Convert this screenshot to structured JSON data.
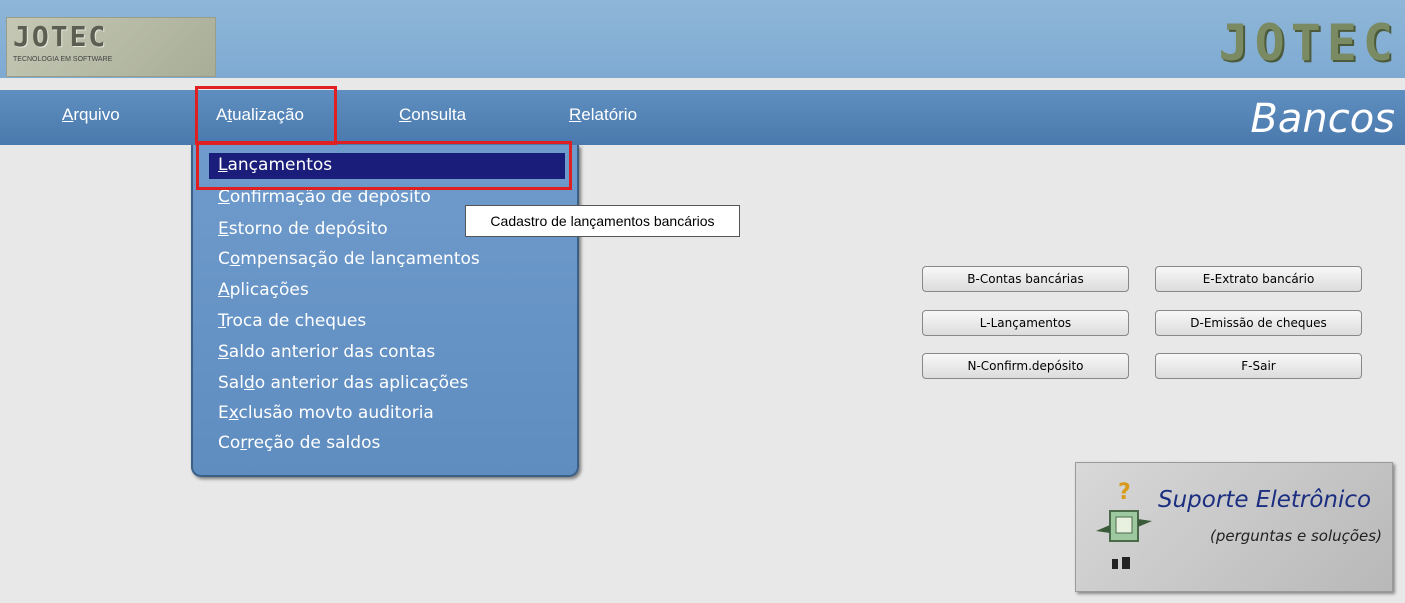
{
  "header": {
    "logo_text": "JOTEC",
    "logo_subtitle": "TECNOLOGIA EM SOFTWARE",
    "brand_text": "JOTEC"
  },
  "menubar": {
    "items": [
      {
        "label_hotkey": "A",
        "label_rest": "rquivo"
      },
      {
        "label_pre": "A",
        "label_hotkey": "t",
        "label_rest": "ualização"
      },
      {
        "label_hotkey": "C",
        "label_rest": "onsulta"
      },
      {
        "label_hotkey": "R",
        "label_rest": "elatório"
      }
    ],
    "page_title": "Bancos"
  },
  "dropdown": {
    "items": [
      {
        "pre": "",
        "hotkey": "L",
        "rest": "ançamentos",
        "selected": true
      },
      {
        "pre": "",
        "hotkey": "C",
        "rest": "onfirmação de depósito"
      },
      {
        "pre": "",
        "hotkey": "E",
        "rest": "storno de depósito"
      },
      {
        "pre": "C",
        "hotkey": "o",
        "rest": "mpensação de lançamentos"
      },
      {
        "pre": "",
        "hotkey": "A",
        "rest": "plicações"
      },
      {
        "pre": "",
        "hotkey": "T",
        "rest": "roca de cheques"
      },
      {
        "pre": "",
        "hotkey": "S",
        "rest": "aldo anterior das contas"
      },
      {
        "pre": "Sal",
        "hotkey": "d",
        "rest": "o anterior das aplicações"
      },
      {
        "pre": "E",
        "hotkey": "x",
        "rest": "clusão movto auditoria"
      },
      {
        "pre": "Co",
        "hotkey": "r",
        "rest": "reção de saldos"
      }
    ]
  },
  "tooltip": "Cadastro de lançamentos bancários",
  "buttons": {
    "contas": "B-Contas bancárias",
    "extrato": "E-Extrato bancário",
    "lancamentos": "L-Lançamentos",
    "emissao": "D-Emissão de cheques",
    "confirm": "N-Confirm.depósito",
    "sair": "F-Sair"
  },
  "support": {
    "title": "Suporte Eletrônico",
    "subtitle": "(perguntas e soluções)",
    "icon": "help-question-icon"
  },
  "colors": {
    "menubar": "#4a79ad",
    "dropdown": "#6f9bcc",
    "selected": "#1a1e7a",
    "highlight": "#e02020"
  }
}
